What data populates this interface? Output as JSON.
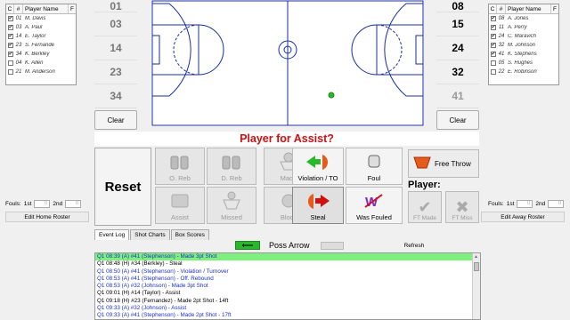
{
  "home_roster": {
    "headers": [
      "C",
      "#",
      "Player Name",
      "F"
    ],
    "players": [
      {
        "checked": true,
        "num": "01",
        "name": "M. Davis"
      },
      {
        "checked": true,
        "num": "03",
        "name": "A. Paul"
      },
      {
        "checked": true,
        "num": "14",
        "name": "E. Taylor"
      },
      {
        "checked": true,
        "num": "23",
        "name": "S. Fernande"
      },
      {
        "checked": true,
        "num": "34",
        "name": "K. Berkley"
      },
      {
        "checked": false,
        "num": "04",
        "name": "K. Allen"
      },
      {
        "checked": false,
        "num": "21",
        "name": "M. Anderson"
      }
    ]
  },
  "away_roster": {
    "headers": [
      "C",
      "#",
      "Player Name",
      "F"
    ],
    "players": [
      {
        "checked": true,
        "num": "08",
        "name": "A. Jones"
      },
      {
        "checked": true,
        "num": "11",
        "name": "A. Perry"
      },
      {
        "checked": true,
        "num": "24",
        "name": "C. Maravich"
      },
      {
        "checked": true,
        "num": "32",
        "name": "M. Johnson"
      },
      {
        "checked": true,
        "num": "41",
        "name": "K. Stephens"
      },
      {
        "checked": false,
        "num": "05",
        "name": "S. Hughes"
      },
      {
        "checked": false,
        "num": "22",
        "name": "E. Robinson"
      }
    ]
  },
  "home_numbers": [
    "01",
    "03",
    "14",
    "23",
    "34"
  ],
  "away_numbers": [
    "08",
    "15",
    "24",
    "32",
    "41"
  ],
  "clear_label": "Clear",
  "fouls": {
    "label": "Fouls:",
    "first": "1st",
    "second": "2nd",
    "home_first": "0",
    "home_second": "0",
    "away_first": "0",
    "away_second": "0"
  },
  "edit_home": "Edit Home Roster",
  "edit_away": "Edit Away Roster",
  "prompt": "Player for Assist?",
  "reset": "Reset",
  "actions": {
    "o_reb": "O. Reb",
    "d_reb": "D. Reb",
    "made": "Made",
    "violation": "Violation / TO",
    "foul": "Foul",
    "assist": "Assist",
    "missed": "Missed",
    "block": "Block",
    "steal": "Steal",
    "was_fouled": "Was Fouled",
    "free_throw": "Free Throw",
    "player": "Player:",
    "ft_made": "FT Made",
    "ft_miss": "FT Miss"
  },
  "tabs": [
    "Event Log",
    "Shot Charts",
    "Box Scores"
  ],
  "poss_arrow": "Poss Arrow",
  "refresh": "Refresh",
  "log": [
    {
      "text": "Q1 08:39 (A) #41 (Stephenson) - Made 3pt Shot",
      "team": "away",
      "selected": true
    },
    {
      "text": "Q1 08:48 (H) #34 (Berkley) - Steal",
      "team": "home"
    },
    {
      "text": "Q1 08:50 (A) #41 (Stephenson) - Violation / Turnover",
      "team": "away"
    },
    {
      "text": "Q1 08:53 (A) #41 (Stephenson) - Off. Rebound",
      "team": "away"
    },
    {
      "text": "Q1 08:53 (A) #32 (Johnson) - Made 3pt Shot",
      "team": "away"
    },
    {
      "text": "Q1 09:01 (H) #14 (Taylor) - Assist",
      "team": "home"
    },
    {
      "text": "Q1 09:18 (H) #23 (Fernandez) - Made 2pt Shot - 14ft",
      "team": "home"
    },
    {
      "text": "Q1 09:33 (A) #32 (Johnson) - Assist",
      "team": "away"
    },
    {
      "text": "Q1 09:33 (A) #41 (Stephenson) - Made 2pt Shot - 17ft",
      "team": "away"
    }
  ],
  "colors": {
    "prompt": "#d01010",
    "selected_row": "#7ef07e",
    "away_text": "#1a30c8",
    "court_lines": "#1a2fa0",
    "arrow": "#2ab82a"
  }
}
